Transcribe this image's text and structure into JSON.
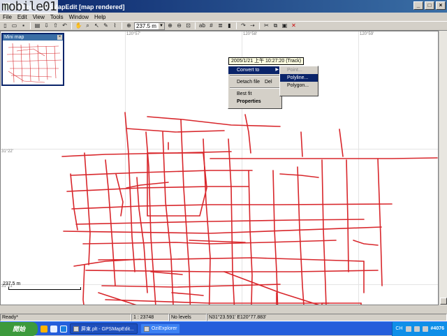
{
  "window": {
    "title": "屏東.plt - GPSMapEdit [map rendered]",
    "watermark": "mobile01",
    "minimize": "_",
    "maximize": "□",
    "close": "×"
  },
  "menu": [
    "File",
    "Edit",
    "View",
    "Tools",
    "Window",
    "Help"
  ],
  "toolbar": {
    "zoom_value": "237.5 m",
    "icons": [
      "new-icon",
      "open-icon",
      "save-icon",
      "print-icon",
      "import-icon",
      "export-icon",
      "undo-icon",
      "hand-icon",
      "zoom-icon",
      "select-icon",
      "pencil-icon",
      "draw-icon",
      "crosshair-icon",
      "zoom-in-icon",
      "zoom-out-icon",
      "fit-icon",
      "labels-icon",
      "grid-icon",
      "layers-icon",
      "lock-icon",
      "redo-icon",
      "cut-icon",
      "copy-icon",
      "paste-icon",
      "delete-icon"
    ]
  },
  "map": {
    "lon_labels": [
      "120°57'",
      "120°58'",
      "120°59'"
    ],
    "lat_labels": [
      "31°22'",
      "31°21'"
    ],
    "scale_label": "237.5 m"
  },
  "minimap": {
    "title": "Mini map",
    "close": "×"
  },
  "tooltip": "2005/1/21 上午 10:27:20 (Track)",
  "context_menu": {
    "items": [
      {
        "label": "Convert to",
        "has_submenu": true
      },
      {
        "label": "Detach file",
        "shortcut": "Del"
      },
      {
        "label": "Best fit"
      },
      {
        "label": "Properties"
      }
    ],
    "submenu": [
      "Point...",
      "Polyline...",
      "Polygon..."
    ]
  },
  "statusbar": {
    "status": "Ready*",
    "scale": "1 : 23748",
    "levels": "No levels",
    "coords": "N31°23.591' E120°77.883'"
  },
  "taskbar": {
    "start": "開始",
    "tasks": [
      "屏東.plt - GPSMapEdit...",
      "OziExplorer"
    ],
    "tray": {
      "lang": "CH",
      "clock": "#4076"
    }
  },
  "colors": {
    "road": "#d8262b",
    "title": "#0a246a",
    "taskbar": "#245edb"
  }
}
